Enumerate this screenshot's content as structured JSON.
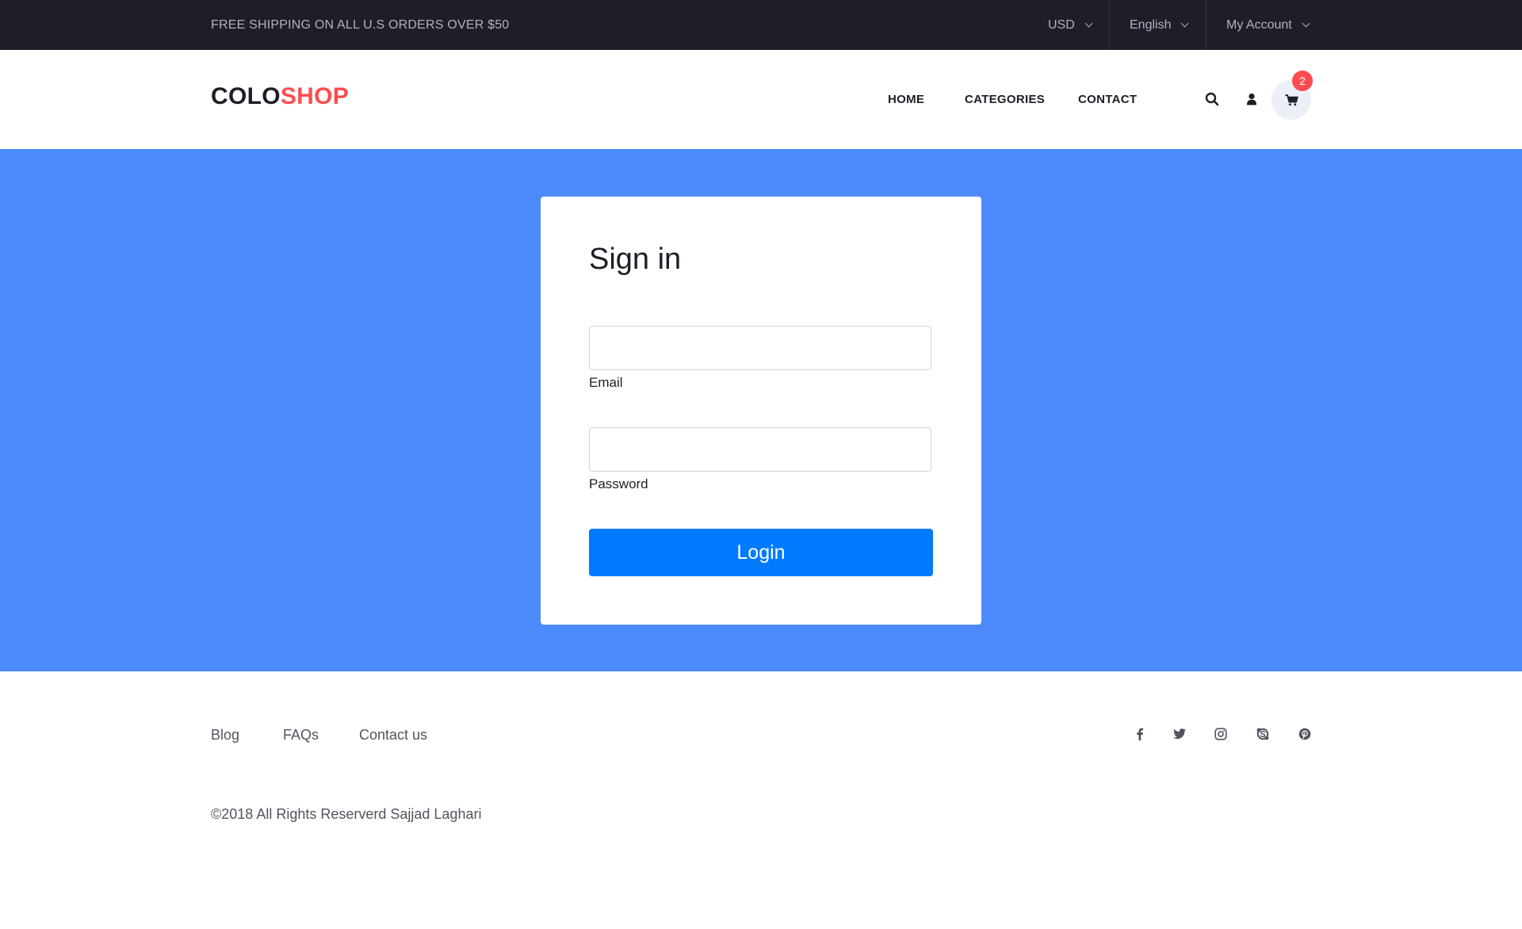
{
  "topbar": {
    "shipping": "FREE SHIPPING ON ALL U.S ORDERS OVER $50",
    "currency": "USD",
    "language": "English",
    "account": "My Account"
  },
  "header": {
    "logo_part1": "COLO",
    "logo_part2": "SHOP",
    "nav": [
      "HOME",
      "CATEGORIES",
      "CONTACT"
    ],
    "cart_count": "2"
  },
  "signin": {
    "title": "Sign in",
    "email_label": "Email",
    "email_value": "",
    "password_label": "Password",
    "password_value": "",
    "login_label": "Login"
  },
  "footer": {
    "links": [
      "Blog",
      "FAQs",
      "Contact us"
    ],
    "social": [
      "facebook-icon",
      "twitter-icon",
      "instagram-icon",
      "skype-icon",
      "pinterest-icon"
    ],
    "copyright": "©2018 All Rights Reserverd Sajjad Laghari"
  },
  "colors": {
    "topbar_bg": "#1e1e27",
    "brand_accent": "#fe4c50",
    "hero_bg": "#4d8af9",
    "button_bg": "#007bff"
  }
}
